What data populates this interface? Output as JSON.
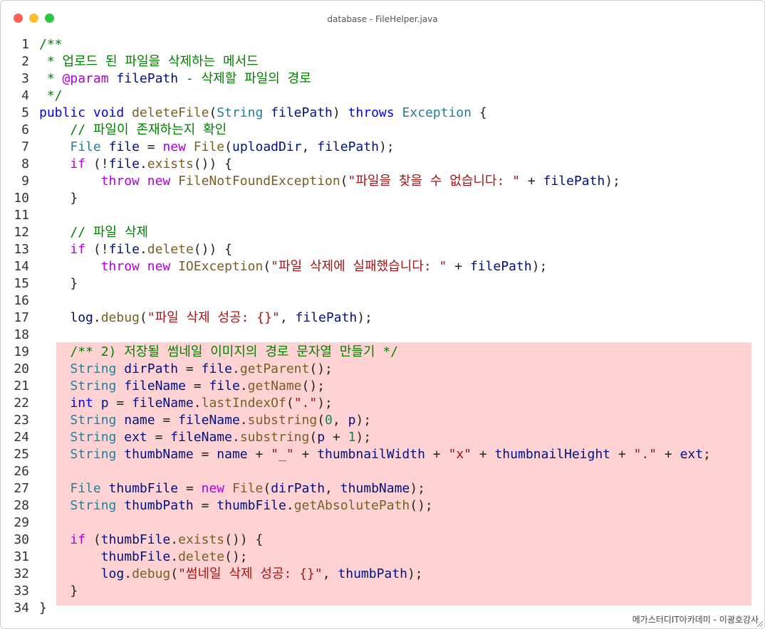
{
  "window": {
    "title": "database - FileHelper.java",
    "footer": "메가스터디IT아카데미 - 이광호강사"
  },
  "colors": {
    "comment": "#008000",
    "keyword": "#0000ff",
    "control": "#af00db",
    "type": "#267f99",
    "function": "#795e26",
    "string": "#a31515",
    "variable": "#001080",
    "number": "#098658",
    "highlight": "#ffd3d3"
  },
  "highlight": {
    "from_line": 19,
    "to_line": 33
  },
  "code": [
    {
      "n": "1",
      "t": [
        [
          "comment",
          "/**"
        ]
      ]
    },
    {
      "n": "2",
      "t": [
        [
          "comment",
          " * 업로드 된 파일을 삭제하는 메서드"
        ]
      ]
    },
    {
      "n": "3",
      "t": [
        [
          "comment",
          " * "
        ],
        [
          "control",
          "@param"
        ],
        [
          "comment",
          " "
        ],
        [
          "variable",
          "filePath"
        ],
        [
          "comment",
          " - 삭제할 파일의 경로"
        ]
      ]
    },
    {
      "n": "4",
      "t": [
        [
          "comment",
          " */"
        ]
      ]
    },
    {
      "n": "5",
      "t": [
        [
          "keyword",
          "public"
        ],
        [
          "plain",
          " "
        ],
        [
          "keyword",
          "void"
        ],
        [
          "plain",
          " "
        ],
        [
          "function",
          "deleteFile"
        ],
        [
          "plain",
          "("
        ],
        [
          "type",
          "String"
        ],
        [
          "plain",
          " "
        ],
        [
          "variable",
          "filePath"
        ],
        [
          "plain",
          ") "
        ],
        [
          "keyword",
          "throws"
        ],
        [
          "plain",
          " "
        ],
        [
          "type",
          "Exception"
        ],
        [
          "plain",
          " {"
        ]
      ]
    },
    {
      "n": "6",
      "t": [
        [
          "plain",
          "    "
        ],
        [
          "comment",
          "// 파일이 존재하는지 확인"
        ]
      ]
    },
    {
      "n": "7",
      "t": [
        [
          "plain",
          "    "
        ],
        [
          "type",
          "File"
        ],
        [
          "plain",
          " "
        ],
        [
          "variable",
          "file"
        ],
        [
          "plain",
          " = "
        ],
        [
          "control",
          "new"
        ],
        [
          "plain",
          " "
        ],
        [
          "function",
          "File"
        ],
        [
          "plain",
          "("
        ],
        [
          "variable",
          "uploadDir"
        ],
        [
          "plain",
          ", "
        ],
        [
          "variable",
          "filePath"
        ],
        [
          "plain",
          ");"
        ]
      ]
    },
    {
      "n": "8",
      "t": [
        [
          "plain",
          "    "
        ],
        [
          "control",
          "if"
        ],
        [
          "plain",
          " (!"
        ],
        [
          "variable",
          "file"
        ],
        [
          "plain",
          "."
        ],
        [
          "function",
          "exists"
        ],
        [
          "plain",
          "()) {"
        ]
      ]
    },
    {
      "n": "9",
      "t": [
        [
          "plain",
          "        "
        ],
        [
          "control",
          "throw"
        ],
        [
          "plain",
          " "
        ],
        [
          "control",
          "new"
        ],
        [
          "plain",
          " "
        ],
        [
          "function",
          "FileNotFoundException"
        ],
        [
          "plain",
          "("
        ],
        [
          "string",
          "\"파일을 찾을 수 없습니다: \""
        ],
        [
          "plain",
          " + "
        ],
        [
          "variable",
          "filePath"
        ],
        [
          "plain",
          ");"
        ]
      ]
    },
    {
      "n": "10",
      "t": [
        [
          "plain",
          "    }"
        ]
      ]
    },
    {
      "n": "11",
      "t": []
    },
    {
      "n": "12",
      "t": [
        [
          "plain",
          "    "
        ],
        [
          "comment",
          "// 파일 삭제"
        ]
      ]
    },
    {
      "n": "13",
      "t": [
        [
          "plain",
          "    "
        ],
        [
          "control",
          "if"
        ],
        [
          "plain",
          " (!"
        ],
        [
          "variable",
          "file"
        ],
        [
          "plain",
          "."
        ],
        [
          "function",
          "delete"
        ],
        [
          "plain",
          "()) {"
        ]
      ]
    },
    {
      "n": "14",
      "t": [
        [
          "plain",
          "        "
        ],
        [
          "control",
          "throw"
        ],
        [
          "plain",
          " "
        ],
        [
          "control",
          "new"
        ],
        [
          "plain",
          " "
        ],
        [
          "function",
          "IOException"
        ],
        [
          "plain",
          "("
        ],
        [
          "string",
          "\"파일 삭제에 실패했습니다: \""
        ],
        [
          "plain",
          " + "
        ],
        [
          "variable",
          "filePath"
        ],
        [
          "plain",
          ");"
        ]
      ]
    },
    {
      "n": "15",
      "t": [
        [
          "plain",
          "    }"
        ]
      ]
    },
    {
      "n": "16",
      "t": []
    },
    {
      "n": "17",
      "t": [
        [
          "plain",
          "    "
        ],
        [
          "variable",
          "log"
        ],
        [
          "plain",
          "."
        ],
        [
          "function",
          "debug"
        ],
        [
          "plain",
          "("
        ],
        [
          "string",
          "\"파일 삭제 성공: {}\""
        ],
        [
          "plain",
          ", "
        ],
        [
          "variable",
          "filePath"
        ],
        [
          "plain",
          ");"
        ]
      ]
    },
    {
      "n": "18",
      "t": []
    },
    {
      "n": "19",
      "t": [
        [
          "plain",
          "    "
        ],
        [
          "comment",
          "/** 2) 저장될 썸네일 이미지의 경로 문자열 만들기 */"
        ]
      ]
    },
    {
      "n": "20",
      "t": [
        [
          "plain",
          "    "
        ],
        [
          "type",
          "String"
        ],
        [
          "plain",
          " "
        ],
        [
          "variable",
          "dirPath"
        ],
        [
          "plain",
          " = "
        ],
        [
          "variable",
          "file"
        ],
        [
          "plain",
          "."
        ],
        [
          "function",
          "getParent"
        ],
        [
          "plain",
          "();"
        ]
      ]
    },
    {
      "n": "21",
      "t": [
        [
          "plain",
          "    "
        ],
        [
          "type",
          "String"
        ],
        [
          "plain",
          " "
        ],
        [
          "variable",
          "fileName"
        ],
        [
          "plain",
          " = "
        ],
        [
          "variable",
          "file"
        ],
        [
          "plain",
          "."
        ],
        [
          "function",
          "getName"
        ],
        [
          "plain",
          "();"
        ]
      ]
    },
    {
      "n": "22",
      "t": [
        [
          "plain",
          "    "
        ],
        [
          "keyword",
          "int"
        ],
        [
          "plain",
          " "
        ],
        [
          "variable",
          "p"
        ],
        [
          "plain",
          " = "
        ],
        [
          "variable",
          "fileName"
        ],
        [
          "plain",
          "."
        ],
        [
          "function",
          "lastIndexOf"
        ],
        [
          "plain",
          "("
        ],
        [
          "string",
          "\".\""
        ],
        [
          "plain",
          ");"
        ]
      ]
    },
    {
      "n": "23",
      "t": [
        [
          "plain",
          "    "
        ],
        [
          "type",
          "String"
        ],
        [
          "plain",
          " "
        ],
        [
          "variable",
          "name"
        ],
        [
          "plain",
          " = "
        ],
        [
          "variable",
          "fileName"
        ],
        [
          "plain",
          "."
        ],
        [
          "function",
          "substring"
        ],
        [
          "plain",
          "("
        ],
        [
          "number",
          "0"
        ],
        [
          "plain",
          ", "
        ],
        [
          "variable",
          "p"
        ],
        [
          "plain",
          ");"
        ]
      ]
    },
    {
      "n": "24",
      "t": [
        [
          "plain",
          "    "
        ],
        [
          "type",
          "String"
        ],
        [
          "plain",
          " "
        ],
        [
          "variable",
          "ext"
        ],
        [
          "plain",
          " = "
        ],
        [
          "variable",
          "fileName"
        ],
        [
          "plain",
          "."
        ],
        [
          "function",
          "substring"
        ],
        [
          "plain",
          "("
        ],
        [
          "variable",
          "p"
        ],
        [
          "plain",
          " + "
        ],
        [
          "number",
          "1"
        ],
        [
          "plain",
          ");"
        ]
      ]
    },
    {
      "n": "25",
      "t": [
        [
          "plain",
          "    "
        ],
        [
          "type",
          "String"
        ],
        [
          "plain",
          " "
        ],
        [
          "variable",
          "thumbName"
        ],
        [
          "plain",
          " = "
        ],
        [
          "variable",
          "name"
        ],
        [
          "plain",
          " + "
        ],
        [
          "string",
          "\"_\""
        ],
        [
          "plain",
          " + "
        ],
        [
          "variable",
          "thumbnailWidth"
        ],
        [
          "plain",
          " + "
        ],
        [
          "string",
          "\"x\""
        ],
        [
          "plain",
          " + "
        ],
        [
          "variable",
          "thumbnailHeight"
        ],
        [
          "plain",
          " + "
        ],
        [
          "string",
          "\".\""
        ],
        [
          "plain",
          " + "
        ],
        [
          "variable",
          "ext"
        ],
        [
          "plain",
          ";"
        ]
      ]
    },
    {
      "n": "26",
      "t": []
    },
    {
      "n": "27",
      "t": [
        [
          "plain",
          "    "
        ],
        [
          "type",
          "File"
        ],
        [
          "plain",
          " "
        ],
        [
          "variable",
          "thumbFile"
        ],
        [
          "plain",
          " = "
        ],
        [
          "control",
          "new"
        ],
        [
          "plain",
          " "
        ],
        [
          "function",
          "File"
        ],
        [
          "plain",
          "("
        ],
        [
          "variable",
          "dirPath"
        ],
        [
          "plain",
          ", "
        ],
        [
          "variable",
          "thumbName"
        ],
        [
          "plain",
          ");"
        ]
      ]
    },
    {
      "n": "28",
      "t": [
        [
          "plain",
          "    "
        ],
        [
          "type",
          "String"
        ],
        [
          "plain",
          " "
        ],
        [
          "variable",
          "thumbPath"
        ],
        [
          "plain",
          " = "
        ],
        [
          "variable",
          "thumbFile"
        ],
        [
          "plain",
          "."
        ],
        [
          "function",
          "getAbsolutePath"
        ],
        [
          "plain",
          "();"
        ]
      ]
    },
    {
      "n": "29",
      "t": []
    },
    {
      "n": "30",
      "t": [
        [
          "plain",
          "    "
        ],
        [
          "control",
          "if"
        ],
        [
          "plain",
          " ("
        ],
        [
          "variable",
          "thumbFile"
        ],
        [
          "plain",
          "."
        ],
        [
          "function",
          "exists"
        ],
        [
          "plain",
          "()) {"
        ]
      ]
    },
    {
      "n": "31",
      "t": [
        [
          "plain",
          "        "
        ],
        [
          "variable",
          "thumbFile"
        ],
        [
          "plain",
          "."
        ],
        [
          "function",
          "delete"
        ],
        [
          "plain",
          "();"
        ]
      ]
    },
    {
      "n": "32",
      "t": [
        [
          "plain",
          "        "
        ],
        [
          "variable",
          "log"
        ],
        [
          "plain",
          "."
        ],
        [
          "function",
          "debug"
        ],
        [
          "plain",
          "("
        ],
        [
          "string",
          "\"썸네일 삭제 성공: {}\""
        ],
        [
          "plain",
          ", "
        ],
        [
          "variable",
          "thumbPath"
        ],
        [
          "plain",
          ");"
        ]
      ]
    },
    {
      "n": "33",
      "t": [
        [
          "plain",
          "    }"
        ]
      ]
    },
    {
      "n": "34",
      "t": [
        [
          "plain",
          "}"
        ]
      ]
    }
  ]
}
